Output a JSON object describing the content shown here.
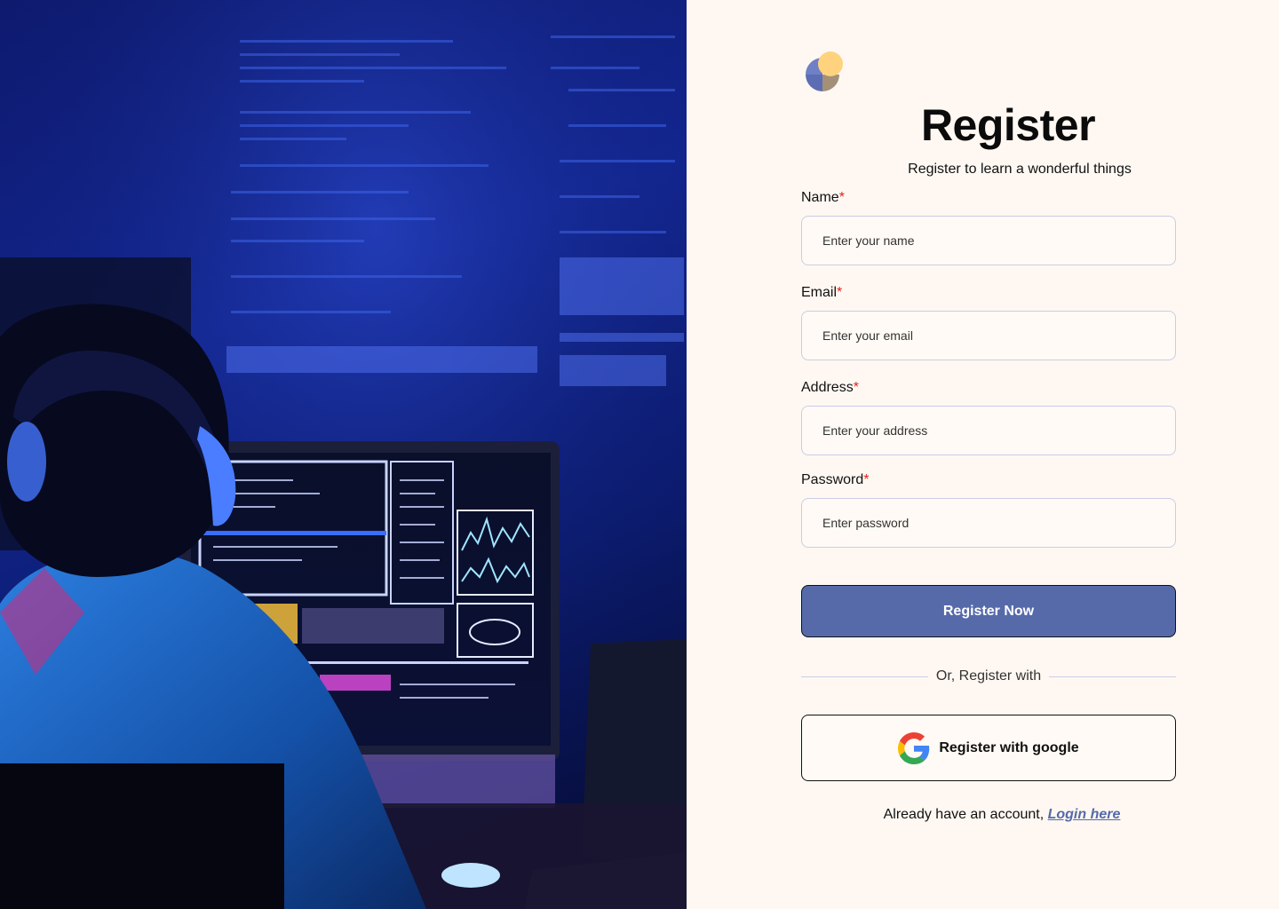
{
  "hero": {
    "image_icon": "developer-at-monitors-photo"
  },
  "brand": {
    "logo_icon": "app-logo-icon",
    "colors": {
      "blue": "#6f80c6",
      "tan": "#a39077",
      "yellow": "#ffd27d"
    }
  },
  "header": {
    "title": "Register",
    "subtitle": "Register to learn a wonderful things"
  },
  "form": {
    "required_marker": "*",
    "name": {
      "label": "Name",
      "placeholder": "Enter your name"
    },
    "email": {
      "label": "Email",
      "placeholder": "Enter your email"
    },
    "address": {
      "label": "Address",
      "placeholder": "Enter your address"
    },
    "password": {
      "label": "Password",
      "placeholder": "Enter password"
    },
    "submit_label": "Register Now"
  },
  "divider": {
    "text": "Or, Register with"
  },
  "google": {
    "label": "Register with google",
    "icon": "google-icon"
  },
  "footer": {
    "prompt": "Already have an account, ",
    "link_label": "Login here"
  },
  "theme": {
    "accent": "#566aaa",
    "background": "#fff8f2",
    "required": "#e0201d",
    "border": "#c9cde6"
  }
}
